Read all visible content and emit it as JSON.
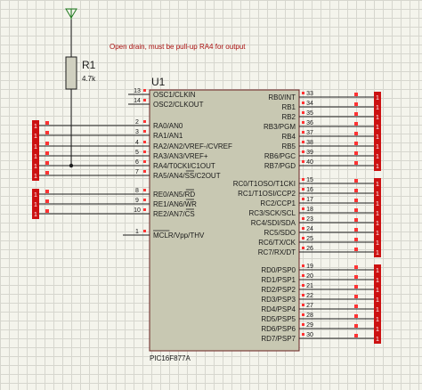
{
  "colors": {
    "connector": "#cc1111",
    "pin_dot": "#ff3333",
    "chip_fill": "#c8c8b2",
    "ground_arrow": "#1e7a1e",
    "note": "#aa1111"
  },
  "note": "Open drain, must be pull-up RA4 for output",
  "resistor": {
    "ref": "R1",
    "value": "4.7k"
  },
  "chip": {
    "ref": "U1",
    "part": "PIC16F877A",
    "left_pins": [
      {
        "num": "13",
        "name": "OSC1/CLKIN"
      },
      {
        "num": "14",
        "name": "OSC2/CLKOUT"
      },
      {
        "num": "2",
        "name": "RA0/AN0"
      },
      {
        "num": "3",
        "name": "RA1/AN1"
      },
      {
        "num": "4",
        "name": "RA2/AN2/VREF-/CVREF"
      },
      {
        "num": "5",
        "name": "RA3/AN3/VREF+"
      },
      {
        "num": "6",
        "name": "RA4/T0CKI/C1OUT"
      },
      {
        "num": "7",
        "name": "RA5/AN4/SS/C2OUT"
      },
      {
        "num": "8",
        "name": "RE0/AN5/RD"
      },
      {
        "num": "9",
        "name": "RE1/AN6/WR"
      },
      {
        "num": "10",
        "name": "RE2/AN7/CS"
      },
      {
        "num": "1",
        "name": "MCLR/Vpp/THV"
      }
    ],
    "right_pins": [
      {
        "num": "33",
        "name": "RB0/INT"
      },
      {
        "num": "34",
        "name": "RB1"
      },
      {
        "num": "35",
        "name": "RB2"
      },
      {
        "num": "36",
        "name": "RB3/PGM"
      },
      {
        "num": "37",
        "name": "RB4"
      },
      {
        "num": "38",
        "name": "RB5"
      },
      {
        "num": "39",
        "name": "RB6/PGC"
      },
      {
        "num": "40",
        "name": "RB7/PGD"
      },
      {
        "num": "15",
        "name": "RC0/T1OSO/T1CKI"
      },
      {
        "num": "16",
        "name": "RC1/T1OSI/CCP2"
      },
      {
        "num": "17",
        "name": "RC2/CCP1"
      },
      {
        "num": "18",
        "name": "RC3/SCK/SCL"
      },
      {
        "num": "23",
        "name": "RC4/SDI/SDA"
      },
      {
        "num": "24",
        "name": "RC5/SDO"
      },
      {
        "num": "25",
        "name": "RC6/TX/CK"
      },
      {
        "num": "26",
        "name": "RC7/RX/DT"
      },
      {
        "num": "19",
        "name": "RD0/PSP0"
      },
      {
        "num": "20",
        "name": "RD1/PSP1"
      },
      {
        "num": "21",
        "name": "RD2/PSP2"
      },
      {
        "num": "22",
        "name": "RD3/PSP3"
      },
      {
        "num": "27",
        "name": "RD4/PSP4"
      },
      {
        "num": "28",
        "name": "RD5/PSP5"
      },
      {
        "num": "29",
        "name": "RD6/PSP6"
      },
      {
        "num": "30",
        "name": "RD7/PSP7"
      }
    ]
  },
  "connector_label": "1"
}
